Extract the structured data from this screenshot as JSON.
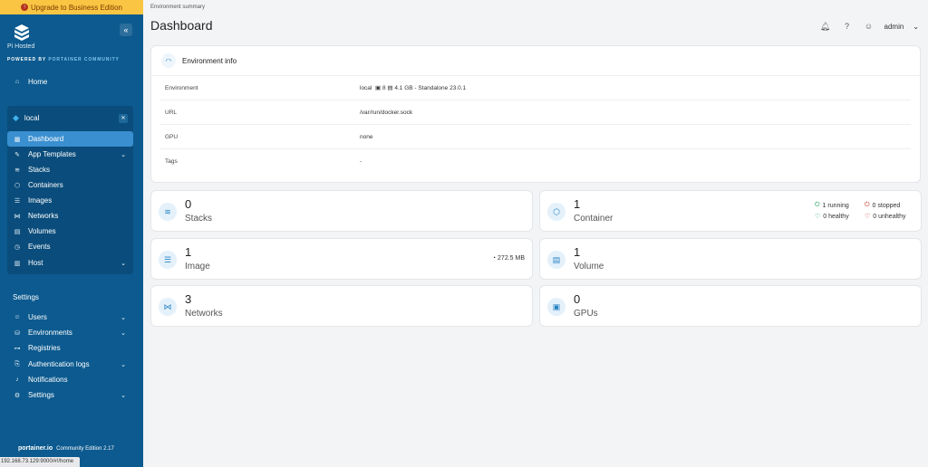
{
  "upgrade": {
    "label": "Upgrade to Business Edition"
  },
  "brand": {
    "name": "Pi Hosted",
    "powered_prefix": "POWERED BY",
    "powered_accent": "PORTAINER COMMUNITY"
  },
  "sidebar": {
    "home": "Home",
    "environment": {
      "name": "local",
      "items": [
        {
          "label": "Dashboard",
          "icon": "dashboard-icon"
        },
        {
          "label": "App Templates",
          "icon": "edit-icon"
        },
        {
          "label": "Stacks",
          "icon": "layers-icon"
        },
        {
          "label": "Containers",
          "icon": "box-icon"
        },
        {
          "label": "Images",
          "icon": "list-icon"
        },
        {
          "label": "Networks",
          "icon": "share-icon"
        },
        {
          "label": "Volumes",
          "icon": "database-icon"
        },
        {
          "label": "Events",
          "icon": "clock-icon"
        },
        {
          "label": "Host",
          "icon": "server-icon"
        }
      ]
    },
    "settings_title": "Settings",
    "settings_items": [
      {
        "label": "Users",
        "icon": "users-icon"
      },
      {
        "label": "Environments",
        "icon": "environment-icon"
      },
      {
        "label": "Registries",
        "icon": "registry-icon"
      },
      {
        "label": "Authentication logs",
        "icon": "log-icon"
      },
      {
        "label": "Notifications",
        "icon": "bell-icon"
      },
      {
        "label": "Settings",
        "icon": "gear-icon"
      }
    ]
  },
  "footer": {
    "logo": "portainer.io",
    "edition": "Community Edition 2.17"
  },
  "statusbar": {
    "url": "192.168.73.129:9000/#!/home"
  },
  "header": {
    "breadcrumb": "Environment summary",
    "title": "Dashboard",
    "user": "admin"
  },
  "env_info": {
    "title": "Environment info",
    "rows": [
      {
        "key": "Environment",
        "value": "local",
        "cpu": "8",
        "mem": "4.1 GB - Standalone 23.0.1"
      },
      {
        "key": "URL",
        "value": "/var/run/docker.sock"
      },
      {
        "key": "GPU",
        "value": "none"
      },
      {
        "key": "Tags",
        "value": "-"
      }
    ]
  },
  "cards": {
    "stacks": {
      "count": "0",
      "label": "Stacks"
    },
    "container": {
      "count": "1",
      "label": "Container",
      "running": "1 running",
      "stopped": "0 stopped",
      "healthy": "0 healthy",
      "unhealthy": "0 unhealthy"
    },
    "image": {
      "count": "1",
      "label": "Image",
      "size": "272.5 MB"
    },
    "volume": {
      "count": "1",
      "label": "Volume"
    },
    "networks": {
      "count": "3",
      "label": "Networks"
    },
    "gpus": {
      "count": "0",
      "label": "GPUs"
    }
  }
}
